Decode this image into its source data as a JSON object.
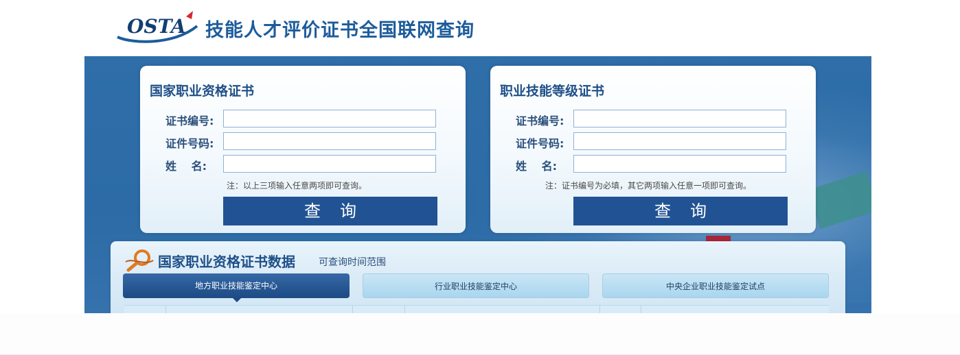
{
  "header": {
    "logo_text": "OSTA",
    "title": "技能人才评价证书全国联网查询"
  },
  "left_card": {
    "title": "国家职业资格证书",
    "cert_no_label": "证书编号:",
    "id_no_label": "证件号码:",
    "name_label": "姓　 名:",
    "cert_no_value": "",
    "id_no_value": "",
    "name_value": "",
    "note": "注：以上三项输入任意两项即可查询。",
    "query_label": "查询"
  },
  "right_card": {
    "title": "职业技能等级证书",
    "cert_no_label": "证书编号:",
    "id_no_label": "证件号码:",
    "name_label": "姓　 名:",
    "cert_no_value": "",
    "id_no_value": "",
    "name_value": "",
    "note": "注：证书编号为必填，其它两项输入任意一项即可查询。",
    "query_label": "查询"
  },
  "data_panel": {
    "title": "国家职业资格证书数据",
    "subtitle": "可查询时间范围",
    "tabs": [
      {
        "label": "地方职业技能鉴定中心",
        "active": true
      },
      {
        "label": "行业职业技能鉴定中心",
        "active": false
      },
      {
        "label": "中央企业职业技能鉴定试点",
        "active": false
      }
    ]
  },
  "colors": {
    "brand_blue": "#1d5c9b",
    "button_blue": "#215394",
    "banner_blue": "#2f6ea9",
    "tab_light": "#a9d6ef"
  }
}
